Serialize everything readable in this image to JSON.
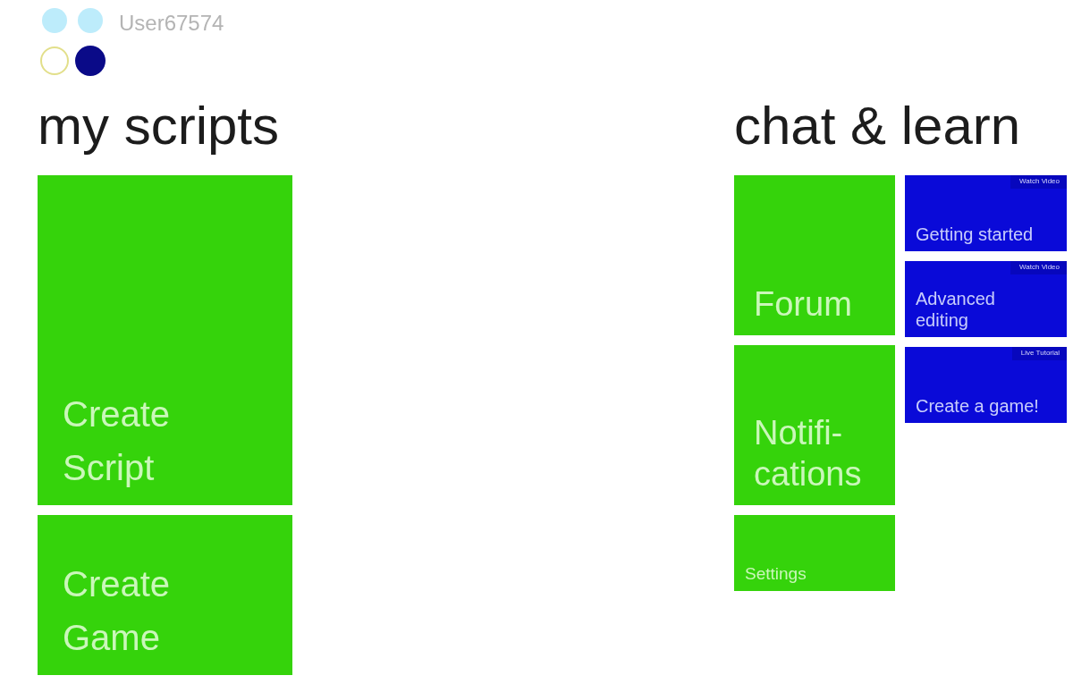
{
  "account": {
    "username": "User67574"
  },
  "sections": [
    {
      "title": "my scripts",
      "columns": [
        [
          {
            "label": "Create Script",
            "kind": "hero"
          },
          {
            "label": "Create Game",
            "kind": "feature"
          }
        ]
      ]
    },
    {
      "title": "chat & learn",
      "columns": [
        [
          {
            "label": "Forum",
            "kind": "feature"
          },
          {
            "label": "Notifi-cations",
            "kind": "feature"
          },
          {
            "label": "Settings",
            "kind": "link"
          }
        ],
        [
          {
            "label": "Getting started",
            "kind": "video",
            "tag": "Watch Video"
          },
          {
            "label": "Advanced editing",
            "kind": "video",
            "tag": "Watch Video"
          },
          {
            "label": "Create a game!",
            "kind": "video",
            "tag": "Live Tutorial"
          }
        ]
      ]
    }
  ]
}
